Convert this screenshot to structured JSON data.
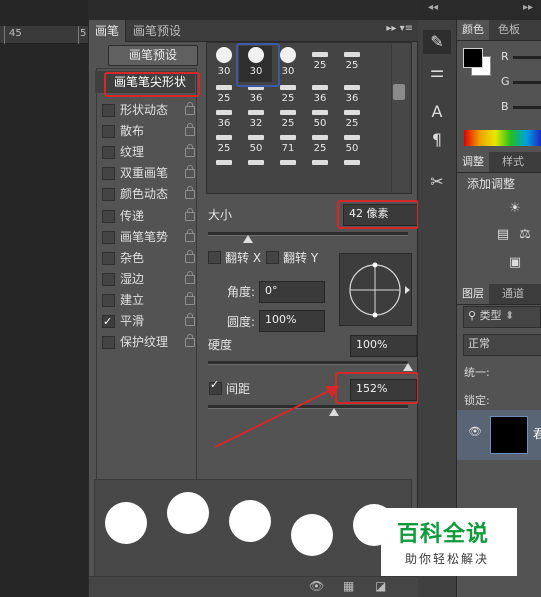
{
  "ruler": {
    "labels": [
      "45",
      "5"
    ]
  },
  "tabs": {
    "brush": "画笔",
    "brush_presets": "画笔预设"
  },
  "panel_menu_icon": "panel-menu-icon",
  "preset_button": "画笔预设",
  "tip_shape": "画笔笔尖形状",
  "options": [
    {
      "label": "形状动态",
      "checked": false
    },
    {
      "label": "散布",
      "checked": false
    },
    {
      "label": "纹理",
      "checked": false
    },
    {
      "label": "双重画笔",
      "checked": false
    },
    {
      "label": "颜色动态",
      "checked": false
    },
    {
      "label": "传递",
      "checked": false
    },
    {
      "label": "画笔笔势",
      "checked": false
    },
    {
      "label": "杂色",
      "checked": false
    },
    {
      "label": "湿边",
      "checked": false
    },
    {
      "label": "建立",
      "checked": false
    },
    {
      "label": "平滑",
      "checked": true
    },
    {
      "label": "保护纹理",
      "checked": false
    }
  ],
  "brushes": [
    {
      "size": "30",
      "shape": "dot"
    },
    {
      "size": "30",
      "shape": "dot"
    },
    {
      "size": "30",
      "shape": "dot"
    },
    {
      "size": "25",
      "shape": "bar"
    },
    {
      "size": "25",
      "shape": "bar"
    },
    {
      "size": "25",
      "shape": "bar"
    },
    {
      "size": "36",
      "shape": "bar"
    },
    {
      "size": "25",
      "shape": "bar"
    },
    {
      "size": "36",
      "shape": "bar"
    },
    {
      "size": "36",
      "shape": "bar"
    },
    {
      "size": "36",
      "shape": "bar"
    },
    {
      "size": "32",
      "shape": "bar"
    },
    {
      "size": "25",
      "shape": "bar"
    },
    {
      "size": "50",
      "shape": "bar"
    },
    {
      "size": "25",
      "shape": "bar"
    },
    {
      "size": "25",
      "shape": "bar"
    },
    {
      "size": "50",
      "shape": "bar"
    },
    {
      "size": "71",
      "shape": "bar"
    },
    {
      "size": "25",
      "shape": "bar"
    },
    {
      "size": "50",
      "shape": "bar"
    },
    {
      "size": "",
      "shape": "bar"
    },
    {
      "size": "",
      "shape": "bar"
    },
    {
      "size": "",
      "shape": "bar"
    },
    {
      "size": "",
      "shape": "bar"
    },
    {
      "size": "",
      "shape": "bar"
    }
  ],
  "size": {
    "label": "大小",
    "value": "42 像素",
    "slider_fraction": 0.2
  },
  "flip": {
    "x_label": "翻转 X",
    "y_label": "翻转 Y",
    "x_checked": false,
    "y_checked": false
  },
  "angle": {
    "label": "角度:",
    "value": "0°"
  },
  "roundness": {
    "label": "圆度:",
    "value": "100%"
  },
  "hardness": {
    "label": "硬度",
    "value": "100%",
    "slider_fraction": 1.0
  },
  "spacing": {
    "label": "间距",
    "value": "152%",
    "checked": true,
    "slider_fraction": 0.63
  },
  "right": {
    "color_tabs": [
      "颜色",
      "色板"
    ],
    "channels": [
      "R",
      "G",
      "B"
    ],
    "adjust_tabs": [
      "调整",
      "样式"
    ],
    "add_adjustment": "添加调整",
    "layer_tabs": [
      "图层",
      "通道"
    ],
    "kind_filter": "类型",
    "blend_mode": "正常",
    "unify_label": "统一:",
    "lock_label": "锁定:",
    "layer_name_fragment": "君"
  },
  "watermark": {
    "title": "百科全说",
    "subtitle": "助你轻松解决"
  },
  "colors": {
    "annotation": "#d62828",
    "selected_blue": "#3c5aa6",
    "watermark_green": "#0f9b3c"
  }
}
